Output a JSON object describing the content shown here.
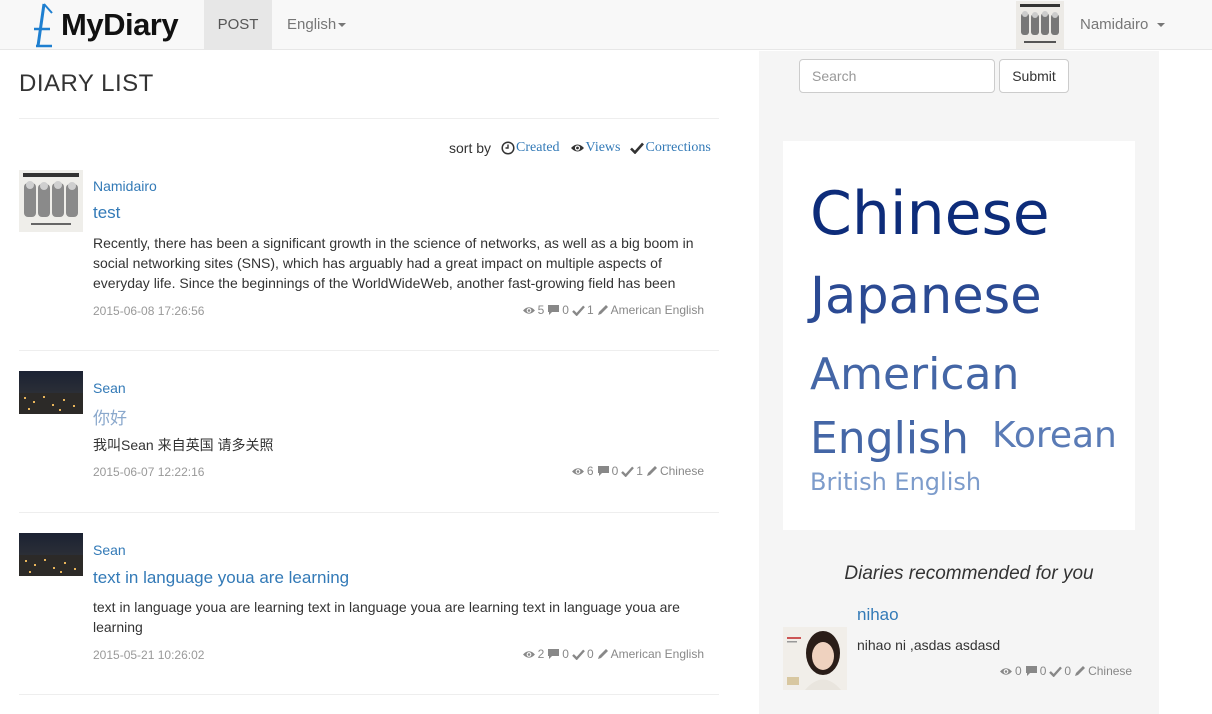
{
  "nav": {
    "brand": "MyDiary",
    "post": "POST",
    "language": "English",
    "user": "Namidairo"
  },
  "main": {
    "title": "DIARY LIST",
    "sort": {
      "label": "sort by",
      "created": "Created",
      "views": "Views",
      "corrections": "Corrections"
    },
    "entries": [
      {
        "author": "Namidairo",
        "title": "test",
        "excerpt": "Recently, there has been a significant growth in the science of networks, as well as a big boom in social networking sites (SNS), which has arguably had a great impact on multiple aspects of everyday life. Since the beginnings of the WorldWideWeb, another fast-growing field has been",
        "date": "2015-06-08 17:26:56",
        "views": "5",
        "comments": "0",
        "corrections": "1",
        "language": "American English"
      },
      {
        "author": "Sean",
        "title": "你好",
        "excerpt": "我叫Sean 来自英国 请多关照",
        "date": "2015-06-07 12:22:16",
        "views": "6",
        "comments": "0",
        "corrections": "1",
        "language": "Chinese"
      },
      {
        "author": "Sean",
        "title": "text in language youa are learning",
        "excerpt": "text in language youa are learning text in language youa are learning text in language youa are learning",
        "date": "2015-05-21 10:26:02",
        "views": "2",
        "comments": "0",
        "corrections": "0",
        "language": "American English"
      }
    ]
  },
  "sidebar": {
    "search_placeholder": "Search",
    "submit": "Submit",
    "tags": [
      {
        "label": "Chinese",
        "color": "#0d2c7a"
      },
      {
        "label": "Japanese",
        "color": "#2b4a93"
      },
      {
        "label": "American English",
        "color": "#4466a6"
      },
      {
        "label": "Korean",
        "color": "#5a7bb6"
      },
      {
        "label": "British English",
        "color": "#7d9ccb"
      }
    ],
    "recommended_title": "Diaries recommended for you",
    "recommended": {
      "title": "nihao",
      "excerpt": "nihao ni ,asdas asdasd",
      "views": "0",
      "comments": "0",
      "corrections": "0",
      "language": "Chinese"
    }
  },
  "colors": {
    "link": "#337ab7",
    "navbar_bg": "#f8f8f8",
    "sidebar_bg": "#f5f5f5"
  }
}
